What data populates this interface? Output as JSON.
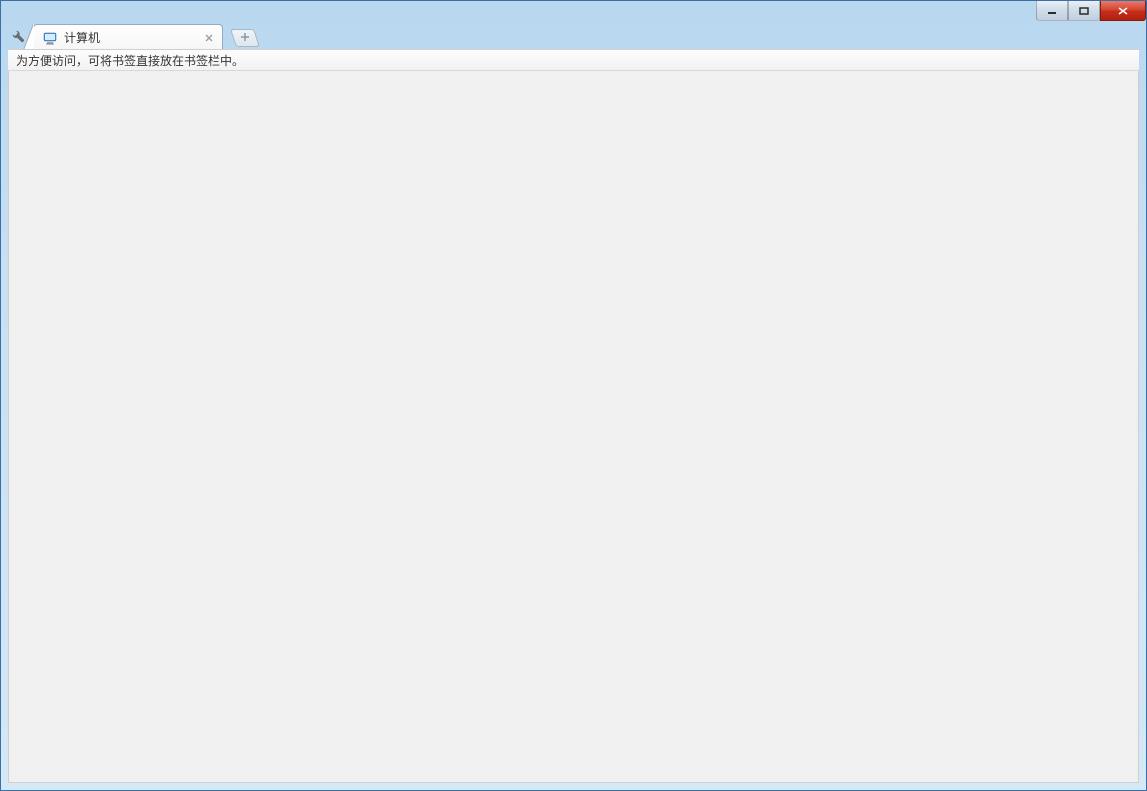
{
  "window": {
    "controls": {
      "minimize_icon": "minimize",
      "maximize_icon": "maximize",
      "close_icon": "close"
    }
  },
  "tabstrip": {
    "wrench_icon": "wrench",
    "tabs": [
      {
        "favicon": "computer",
        "title": "计算机",
        "close_icon": "x"
      }
    ],
    "newtab_icon": "+"
  },
  "bookmark_bar": {
    "hint": "为方便访问，可将书签直接放在书签栏中。"
  }
}
